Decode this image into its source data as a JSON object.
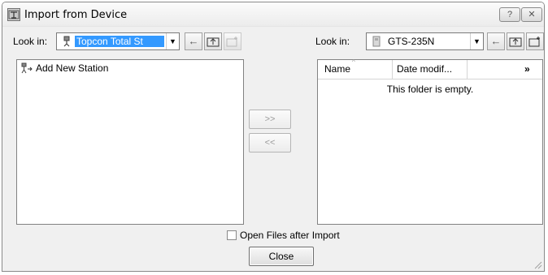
{
  "window": {
    "title": "Import from Device",
    "help_label": "?",
    "close_label": "✕"
  },
  "left": {
    "look_in_label": "Look in:",
    "location_value": "Topcon Total St",
    "tree_items": [
      {
        "label": "Add New Station",
        "icon": "add-station-icon"
      }
    ]
  },
  "right": {
    "look_in_label": "Look in:",
    "location_value": "GTS-235N",
    "columns": [
      "Name",
      "Date modif...",
      "»"
    ],
    "empty_message": "This folder is empty."
  },
  "transfer": {
    "forward_label": ">>",
    "back_label": "<<"
  },
  "footer": {
    "open_after_import_label": "Open Files after Import",
    "open_after_import_checked": false,
    "close_label": "Close"
  },
  "colors": {
    "selection": "#3399ff",
    "window_bg": "#f0f0f0"
  }
}
